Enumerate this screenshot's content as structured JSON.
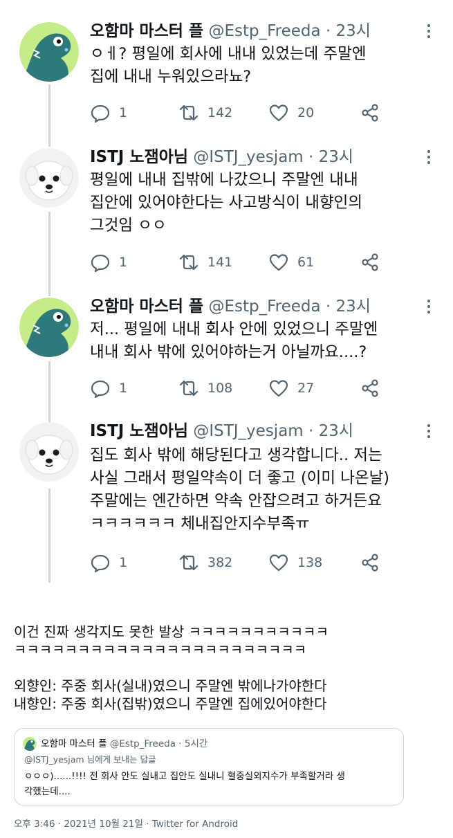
{
  "tweets": [
    {
      "author": "오함마 마스터 플",
      "handle": "@Estp_Freeda",
      "time": "23시",
      "lines": [
        "ㅇㅔ? 평일에 회사에 내내 있었는데 주말엔",
        "집에 내내 누워있으라뇨?"
      ],
      "avatar_icon": "dinosaur-avatar",
      "replies": "1",
      "retweets": "142",
      "likes": "20"
    },
    {
      "author": "ISTJ 노잼아님",
      "handle": "@ISTJ_yesjam",
      "time": "23시",
      "lines": [
        "평일에 내내 집밖에 나갔으니 주말엔 내내",
        "집안에 있어야한다는 사고방식이 내향인의",
        "그것임 ㅇㅇ"
      ],
      "avatar_icon": "puppy-avatar",
      "replies": "1",
      "retweets": "141",
      "likes": "61"
    },
    {
      "author": "오함마 마스터 플",
      "handle": "@Estp_Freeda",
      "time": "23시",
      "lines": [
        "저... 평일에 내내 회사 안에 있었으니 주말엔",
        "내내 회사 밖에 있어야하는거 아닐까요....?"
      ],
      "avatar_icon": "dinosaur-avatar",
      "replies": "1",
      "retweets": "108",
      "likes": "27"
    },
    {
      "author": "ISTJ 노잼아님",
      "handle": "@ISTJ_yesjam",
      "time": "23시",
      "lines": [
        "집도 회사 밖에 해당된다고 생각합니다.. 저는",
        "사실 그래서 평일약속이 더 좋고 (이미 나온날)",
        "주말에는 엔간하면 약속 안잡으려고 하거든요",
        "ㅋㅋㅋㅋㅋㅋ 체내집안지수부족ㅠ"
      ],
      "avatar_icon": "puppy-avatar",
      "replies": "1",
      "retweets": "382",
      "likes": "138"
    }
  ],
  "caption": {
    "lines": [
      "이건 진짜 생각지도 못한 발상 ㅋㅋㅋㅋㅋㅋㅋㅋㅋㅋㅋ",
      "ㅋㅋㅋㅋㅋㅋㅋㅋㅋㅋㅋㅋㅋㅋㅋㅋㅋㅋㅋㅋㅋㅋㅋ",
      "",
      "외향인: 주중 회사(실내)였으니 주말엔 밖에나가야한다",
      "내향인: 주중 회사(집밖)였으니 주말엔 집에있어야한다"
    ]
  },
  "quote": {
    "author": "오함마 마스터 플",
    "handle": "@Estp_Freeda",
    "time": "5시간",
    "reply_to": "@ISTJ_yesjam 님에게 보내는 답글",
    "lines": [
      "ㅇㅇㅇ)......!!!! 전 회사 안도 실내고 집안도 실내니 혈중실외지수가 부족할거라 생",
      "각했는데...."
    ]
  },
  "footer": "오후 3:46 · 2021년 10월 21일 · Twitter for Android",
  "colors": {
    "text": "#0f1419",
    "secondary": "#536471",
    "thread_line": "#cfd9de",
    "dino_green": "#2e7a7a",
    "avatar_lime": "#c6ec8a"
  }
}
